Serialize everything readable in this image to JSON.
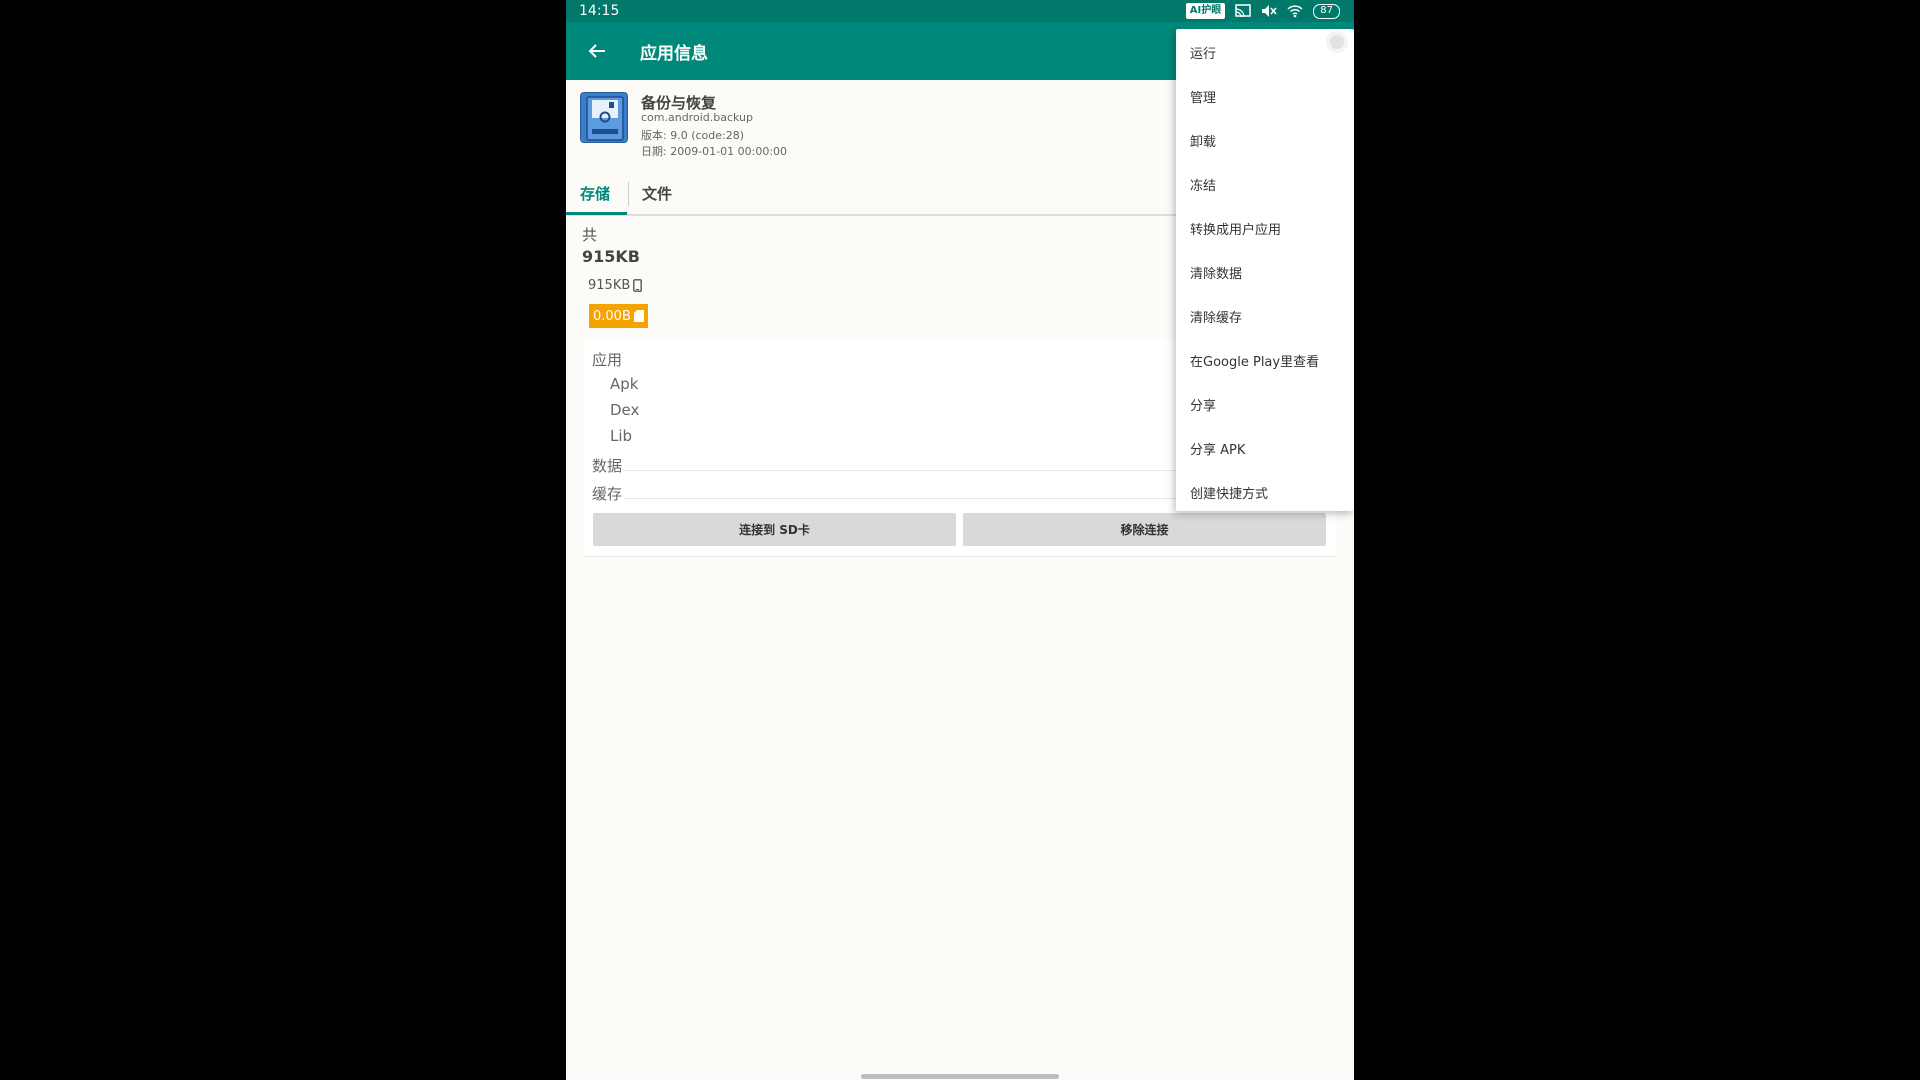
{
  "status_bar": {
    "time": "14:15",
    "ai_badge": "AI护眼",
    "battery": "87",
    "icons": [
      "cast-icon",
      "mute-icon",
      "wifi-icon",
      "battery-icon"
    ]
  },
  "app_bar": {
    "title": "应用信息",
    "back_icon": "arrow-left-icon"
  },
  "app": {
    "name": "备份与恢复",
    "package": "com.android.backup",
    "version": "版本: 9.0 (code:28)",
    "date": "日期: 2009-01-01 00:00:00",
    "icon": "floppy-disk-icon",
    "icon_color": "#3d7ec9"
  },
  "tabs": [
    {
      "label": "存储",
      "active": true
    },
    {
      "label": "文件",
      "active": false
    }
  ],
  "storage": {
    "total_label": "共",
    "total_value": "915KB",
    "internal_value": "915KB",
    "sd_value": "0.00B",
    "sd_color": "#f5a300",
    "breakdown": {
      "app_label": "应用",
      "apk": "Apk",
      "dex": "Dex",
      "lib": "Lib",
      "data_label": "数据",
      "cache_label": "缓存"
    }
  },
  "buttons": {
    "link_sd": "连接到 SD卡",
    "unlink": "移除连接"
  },
  "menu": {
    "items": [
      "运行",
      "管理",
      "卸载",
      "冻结",
      "转换成用户应用",
      "清除数据",
      "清除缓存",
      "在Google Play里查看",
      "分享",
      "分享 APK",
      "创建快捷方式"
    ]
  },
  "colors": {
    "primary": "#00897b",
    "primary_dark": "#00796b"
  }
}
